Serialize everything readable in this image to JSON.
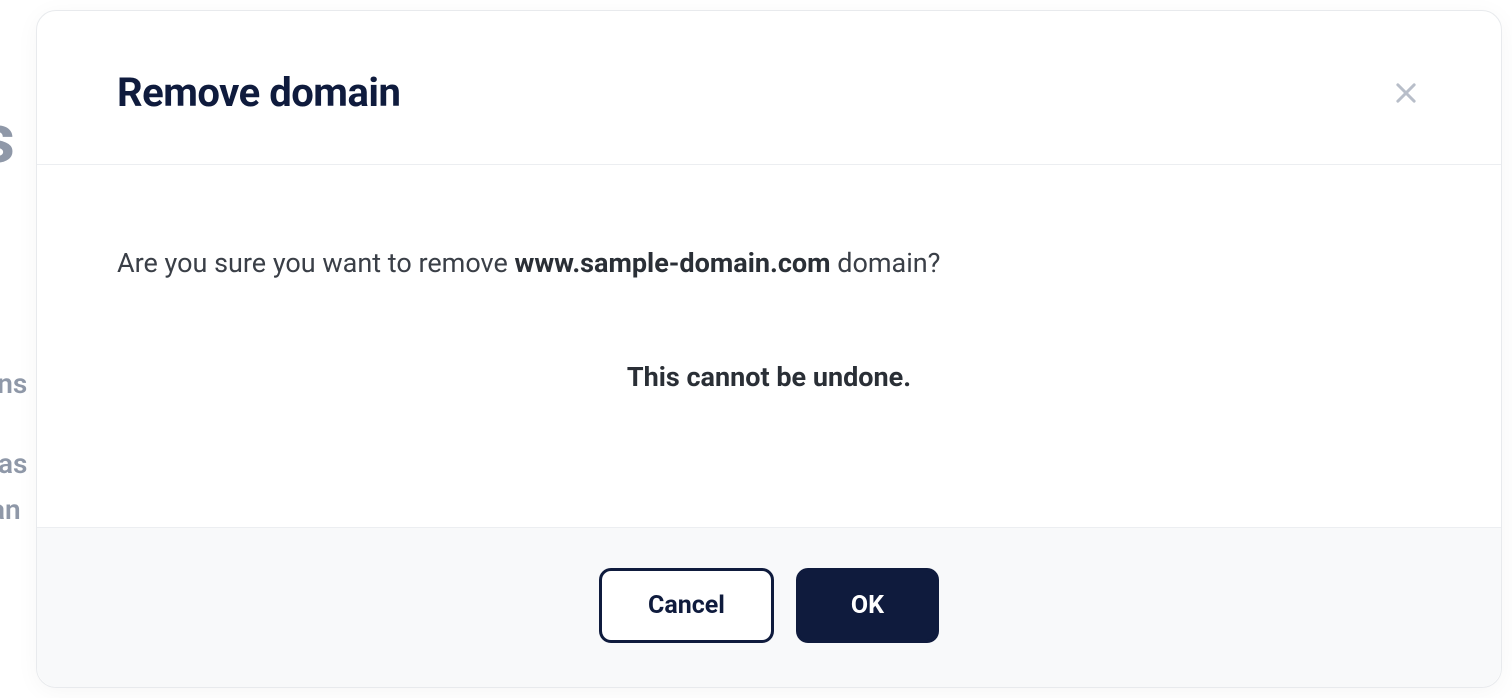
{
  "background": {
    "heading_fragment": "s",
    "line1_fragment": "ins",
    "line2_fragment": "as",
    "line3_fragment": "an"
  },
  "modal": {
    "title": "Remove domain",
    "confirm_prefix": "Are you sure you want to remove ",
    "domain_name": "www.sample-domain.com",
    "confirm_suffix": " domain?",
    "warning": "This cannot be undone.",
    "buttons": {
      "cancel": "Cancel",
      "ok": "OK"
    }
  }
}
